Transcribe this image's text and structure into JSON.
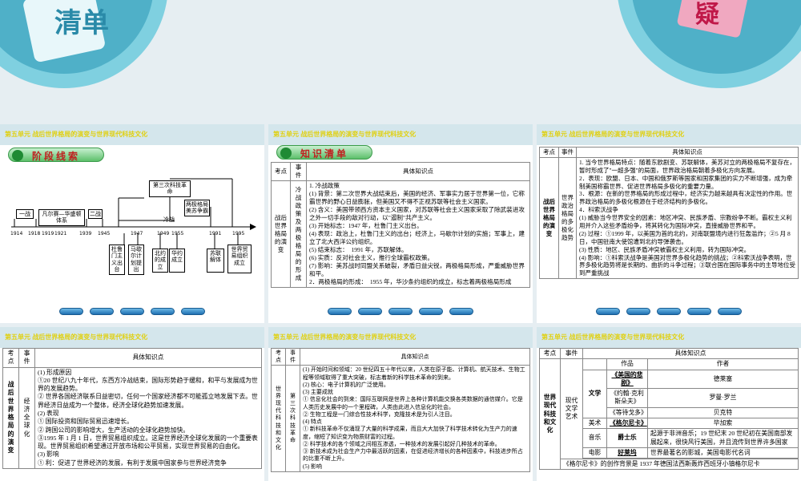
{
  "banners": {
    "left_text": "清单",
    "right_text": "疑"
  },
  "unit_title": "第五单元 战后世界格局的演变与世界现代科技文化",
  "nav_buttons": [
    "",
    "",
    "",
    "",
    ""
  ],
  "panel1": {
    "pill": "阶段线索",
    "timeline": {
      "years": [
        "1914",
        "1918",
        "1919",
        "1921",
        "1939",
        "1945",
        "1947",
        "1949",
        "1955",
        "1991",
        "1995"
      ],
      "above": [
        "一战",
        "凡尔赛—华盛顿体系",
        "二战",
        "冷战",
        "两极格局 美苏争霸",
        "第三次科技革命"
      ],
      "below": [
        "杜鲁门主义出台",
        "马歇尔计划提出",
        "北约的成立",
        "华约成立",
        "苏联解体",
        "世界贸易组织成立"
      ]
    }
  },
  "panel2": {
    "pill": "知识清单",
    "headers": [
      "考点",
      "事件",
      "具体知识点"
    ],
    "col1": "战后世界格局的演变",
    "col2": "冷战政策及两极格局的形成",
    "lines": [
      "1. 冷战政策",
      "(1) 背景：第二次世界大战结束后，美国的经济、军事实力居于世界第一位，它称霸世界的野心日益膨胀，但美国又不得不正视苏联等社会主义国家。",
      "(2) 含义：美国带领西方资本主义国家，对苏联等社会主义国家采取了除武装进攻之外一切手段的敌对行动，以\"遏制\"共产主义。",
      "(3) 开始标志：1947 年，杜鲁门主义出台。",
      "(4) 表现：政治上，杜鲁门主义的出台；经济上，马歇尔计划的实施；军事上，建立了北大西洋公约组织。",
      "(5) 结束标志：　1991 年，苏联解体。",
      "(6) 实质：反对社会主义，推行全球霸权政策。",
      "(7) 影响：美苏战时同盟关系破裂，矛盾日益尖锐，两极格局形成，严重威胁世界和平。",
      "2．两极格局的形成：　1955 年，华沙条约组织的成立，标志着两极格局形成"
    ]
  },
  "panel3": {
    "headers": [
      "考点",
      "事件",
      "具体知识点"
    ],
    "col1": "战后世界格局的演变",
    "col2": "世界政治格局的多极化趋势",
    "lines": [
      "1. 当今世界格局特点：随着东欧剧变、苏联解体，美苏对立的两极格局不复存在，暂时形成了\"一超多强\"的局面，世界政治格局朝着多极化方向发展。",
      "2．表现：欧盟、日本、中国和俄罗斯等国家和国家集团的实力不断增强，成为牵制美国称霸世界、促进世界格局多极化的重要力量。",
      "3．根源：在新的世界格局的形成过程中，经济实力越来越具有决定性的作用。世界政治格局的多极化根源在于经济结构的多极化。",
      "4．科索沃战争",
      "(1) 威胁当今世界安全的因素：地区冲突、民族矛盾、宗教纷争不断。霸权主义利用并介入这些矛盾纷争，将其转化为国际冲突，直接威胁世界和平。",
      "(2) 过程：①1999 年，以美国为首的北约，对南联盟境内进行狂轰滥炸；②5 月 8 日，中国驻南大使馆遭到北约导弹袭击。",
      "(3) 性质：地区、民族矛盾冲突被霸权主义利用，转为国际冲突。",
      "(4) 影响：①科索沃战争是美国对世界多极化趋势的挑战；②科索沃战争表明，世界多极化趋势将是长期的、曲折的斗争过程；③联合国在国际事务中的主导地位受到严重挑战"
    ]
  },
  "panel4": {
    "headers": [
      "考点",
      "事件",
      "具体知识点"
    ],
    "col1": "战后世界格局的演变",
    "col2": "经济全球化",
    "lines": [
      "(1) 形成原因",
      "①20 世纪八九十年代，东西方冷战结束，国际形势趋于缓和，和平与发展成为世界的发展趋势。",
      "② 世界各国经济联系日益密切，任何一个国家经济都不可能孤立地发展下去。世界经济日益成为一个整体，经济全球化趋势加速发展。",
      "(2) 表现",
      "① 国际投资和国际贸易迅速增长。",
      "② 跨国公司的影响增大，生产活动的全球化趋势加快。",
      "③1995 年 1 月 1 日，世界贸易组织成立。这是世界经济全球化发展的一个重要表现。世界贸易组织希望通过开放市场和公平贸易，实现世界贸易的自由化。",
      "(3) 影响",
      "① 利：促进了世界经济的发展，有利于发展中国家参与世界经济竞争"
    ]
  },
  "panel5": {
    "headers": [
      "考点",
      "事件",
      "具体知识点"
    ],
    "col1": "世界现代科技和文化",
    "col2": "第三次科技革命",
    "lines": [
      "(1) 开始时间和领域：20 世纪四五十年代以来，人类在原子能、计算机、航天技术、生物工程等领域取得了重大突破，标志着新的科学技术革命的到来。",
      "(2) 核心：电子计算机的广泛使用。",
      "(3) 主要成就",
      "① 信息化社会的到来：国际互联网是世界上各种计算机能交换各类数据的通信媒介。它是人类历史发展中的一个里程碑，人类由此进入信息化的社会。",
      "② 生物工程是一门综合性技术科学，克隆技术是为引人注目。",
      "(4) 特点",
      "① 新科技革命不仅涌现了大量的科学成果，而且大大加快了科学技术转化为生产力的速度，缩短了知识变为物质财富的过程。",
      "② 科学技术的各个领域之间相互渗透，一种技术的发展引起好几种技术的革命。",
      "③ 新技术成为社会生产力中最活跃的因素，在促进经济增长的各种因素中，科技进步所占的比重不断上升。",
      "(5) 影响"
    ]
  },
  "panel6": {
    "headers": [
      "考点",
      "事件",
      "具体知识点"
    ],
    "col1": "世界现代科技和文化",
    "col2": "现代文学艺术",
    "sub_headers": [
      "作品",
      "作者"
    ],
    "rows": [
      {
        "cat": "文学",
        "work": "《美国的悲剧》",
        "author": "德莱塞"
      },
      {
        "cat": "",
        "work": "《约翰·克利斯朵夫》",
        "author": "罗曼·罗兰"
      },
      {
        "cat": "",
        "work": "《等待戈多》",
        "author": "贝克特"
      },
      {
        "cat": "美术",
        "work": "《格尔尼卡》",
        "author": "毕加索"
      }
    ],
    "music_label": "音乐",
    "jazz_label": "爵士乐",
    "jazz_text": "起源于非洲音乐；19 世纪末 20 世纪初在美国南部发展起来，很快风行美国，并且流传到世界许多国家",
    "film_label": "电影",
    "film_name": "好莱坞",
    "film_text": "世界最著名的影城，美国电影代名词",
    "note": "《格尔尼卡》的创作背景是 1937 年德国法西斯轰炸西班牙小镇格尔尼卡"
  }
}
